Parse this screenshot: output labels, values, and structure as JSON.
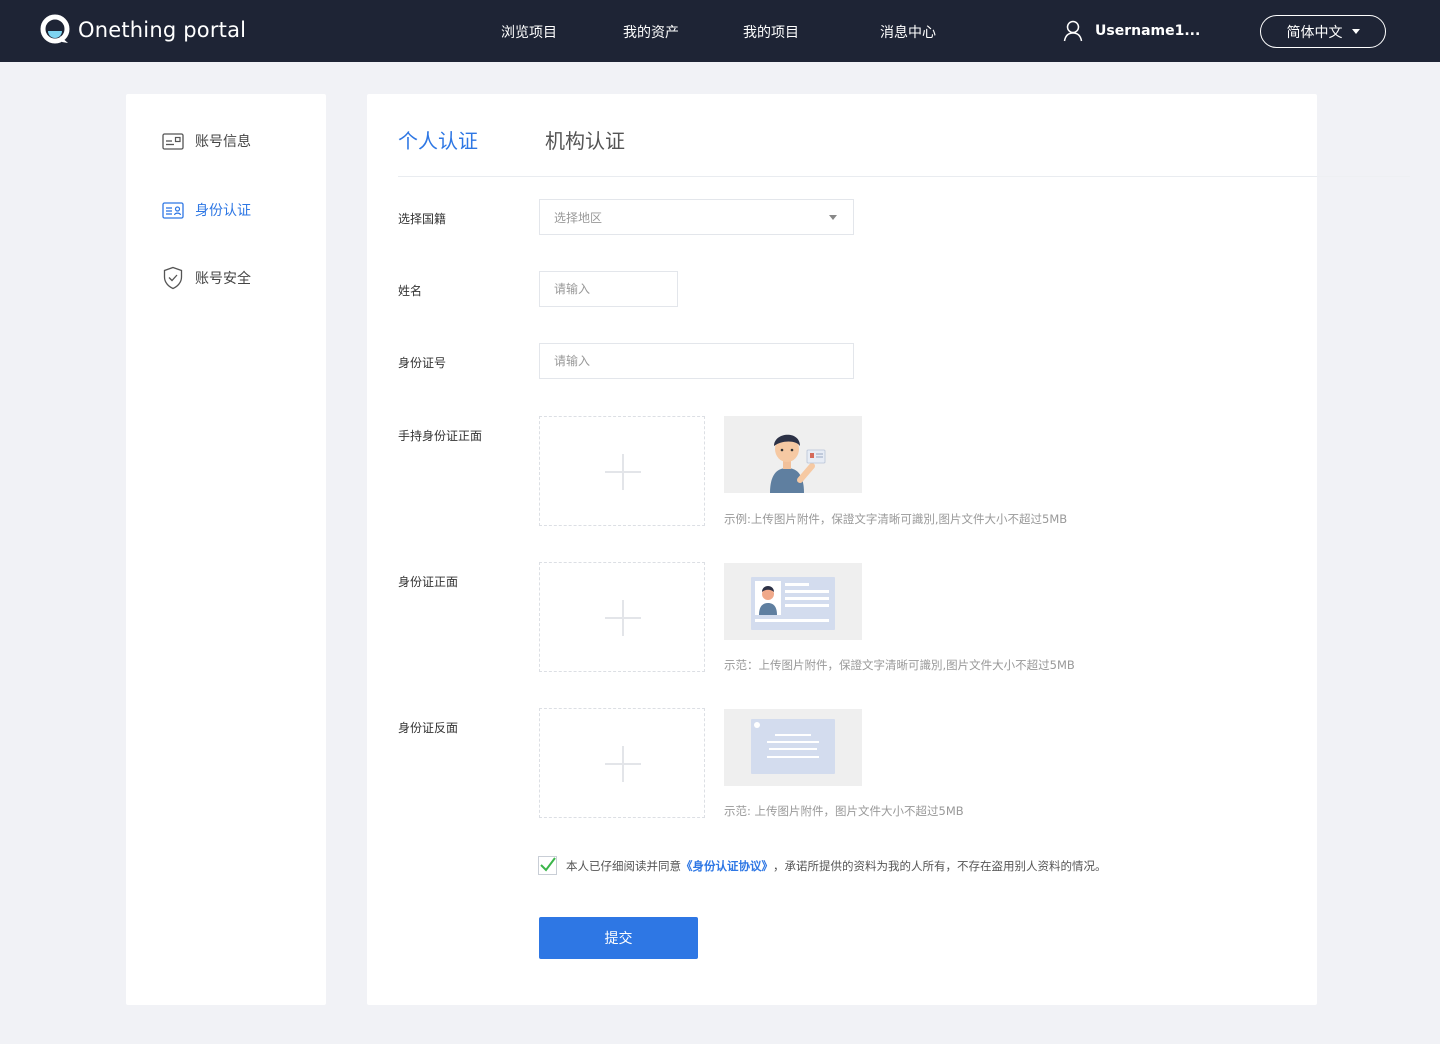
{
  "header": {
    "logo_text": "Onething portal",
    "nav": [
      {
        "label": "浏览项目"
      },
      {
        "label": "我的资产"
      },
      {
        "label": "我的项目"
      },
      {
        "label": "消息中心"
      }
    ],
    "username": "Username1...",
    "language": "简体中文"
  },
  "sidebar": {
    "items": [
      {
        "label": "账号信息",
        "icon": "id-card-icon"
      },
      {
        "label": "身份认证",
        "icon": "identity-card-icon",
        "active": true
      },
      {
        "label": "账号安全",
        "icon": "shield-icon"
      }
    ]
  },
  "tabs": [
    {
      "label": "个人认证",
      "active": true
    },
    {
      "label": "机构认证"
    }
  ],
  "form": {
    "nationality": {
      "label": "选择国籍",
      "placeholder": "选择地区"
    },
    "name": {
      "label": "姓名",
      "placeholder": "请输入"
    },
    "id_number": {
      "label": "身份证号",
      "placeholder": "请输入"
    },
    "handheld": {
      "label": "手持身份证正面",
      "hint": "示例:上传图片附件，保證文字清晰可識別,图片文件大小不超过5MB"
    },
    "front": {
      "label": "身份证正面",
      "hint": "示范：上传图片附件，保證文字清晰可識別,图片文件大小不超过5MB"
    },
    "back": {
      "label": "身份证反面",
      "hint": "示范: 上传图片附件，图片文件大小不超过5MB"
    },
    "agreement": {
      "checked": true,
      "prefix": "本人已仔细阅读并同意",
      "link": "《身份认证协议》",
      "suffix": "，承诺所提供的资料为我的人所有，不存在盗用别人资料的情况。"
    },
    "submit_label": "提交"
  },
  "colors": {
    "header_bg": "#1e2435",
    "accent": "#2e77e4",
    "page_bg": "#f1f2f6",
    "check": "#3bb54a"
  }
}
